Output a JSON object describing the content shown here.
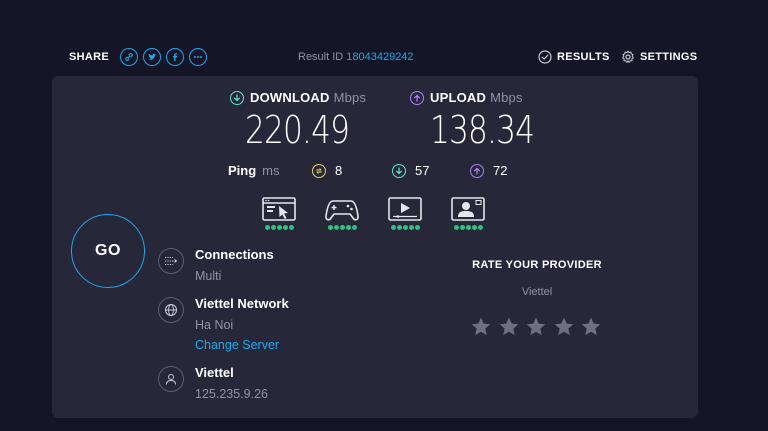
{
  "header": {
    "share_label": "SHARE",
    "share_icons": [
      "link-icon",
      "twitter-icon",
      "facebook-icon",
      "more-icon"
    ],
    "result_label": "Result ID",
    "result_id": "18043429242",
    "results_label": "RESULTS",
    "settings_label": "SETTINGS"
  },
  "download": {
    "label": "DOWNLOAD",
    "unit": "Mbps",
    "value": "220.49"
  },
  "upload": {
    "label": "UPLOAD",
    "unit": "Mbps",
    "value": "138.34"
  },
  "ping": {
    "label": "Ping",
    "unit": "ms",
    "idle": "8",
    "download": "57",
    "upload": "72"
  },
  "apps": [
    {
      "icon": "web-browsing-icon",
      "rating": 5
    },
    {
      "icon": "gaming-icon",
      "rating": 5
    },
    {
      "icon": "video-streaming-icon",
      "rating": 5
    },
    {
      "icon": "video-chat-icon",
      "rating": 5
    }
  ],
  "go_label": "GO",
  "connections": {
    "title": "Connections",
    "value": "Multi"
  },
  "server": {
    "title": "Viettel Network",
    "location": "Ha Noi",
    "change_label": "Change Server"
  },
  "isp": {
    "title": "Viettel",
    "ip": "125.235.9.26"
  },
  "rate": {
    "title": "RATE YOUR PROVIDER",
    "provider": "Viettel",
    "stars": 5
  },
  "colors": {
    "background": "#141526",
    "card": "#26283a",
    "accent": "#1aa7ec",
    "download": "#5fe3d0",
    "upload": "#b77cff",
    "ping_idle": "#f0d060",
    "good": "#2ec27e"
  }
}
